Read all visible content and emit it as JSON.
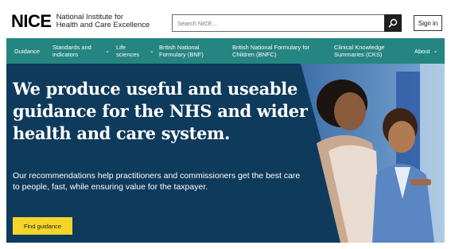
{
  "header": {
    "logo_mark": "NICE",
    "logo_line1": "National Institute for",
    "logo_line2": "Health and Care Excellence",
    "search_placeholder": "Search NICE...",
    "search_icon": "search-icon",
    "signin_label": "Sign in"
  },
  "nav": {
    "items": [
      {
        "label": "Guidance",
        "has_caret": false
      },
      {
        "label": "Standards and indicators",
        "has_caret": true
      },
      {
        "label": "Life sciences",
        "has_caret": true
      },
      {
        "label": "British National Formulary (BNF)",
        "has_caret": false
      },
      {
        "label": "British National Formulary for Children (BNFC)",
        "has_caret": false
      },
      {
        "label": "Clinical Knowledge Summaries (CKS)",
        "has_caret": false
      },
      {
        "label": "About",
        "has_caret": true
      }
    ],
    "caret_glyph": "⌄"
  },
  "hero": {
    "title": "We produce useful and useable guidance for the NHS and wider health and care system.",
    "body": "Our recommendations help practitioners and commissioners get the best care to people, fast, while ensuring value for the taxpayer.",
    "cta_label": "Find guidance"
  },
  "colors": {
    "nav_bg": "#258580",
    "hero_bg": "#0e3a5c",
    "cta_bg": "#f5d52b",
    "search_btn_bg": "#1f1f1f"
  }
}
